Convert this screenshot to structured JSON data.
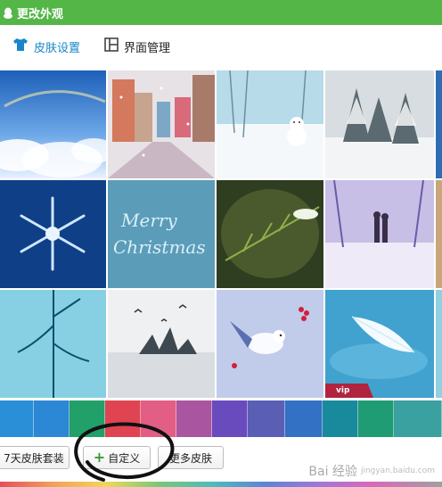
{
  "window": {
    "title": "更改外观"
  },
  "tabs": [
    {
      "label": "皮肤设置",
      "icon": "tshirt-icon",
      "active": true
    },
    {
      "label": "界面管理",
      "icon": "layout-icon",
      "active": false
    }
  ],
  "skins": [
    {
      "theme": "sky-clouds"
    },
    {
      "theme": "snowy-street"
    },
    {
      "theme": "snowman"
    },
    {
      "theme": "snowy-forest"
    },
    {
      "theme": "snowflake"
    },
    {
      "theme": "merry-christmas-frost"
    },
    {
      "theme": "fir-branch-snow"
    },
    {
      "theme": "couple-snow-walk"
    },
    {
      "theme": "frozen-branches"
    },
    {
      "theme": "winter-lake-birds"
    },
    {
      "theme": "bird-red-berries"
    },
    {
      "theme": "white-feather",
      "badge": "vip"
    }
  ],
  "colors": [
    "#2a8fd6",
    "#2c87d4",
    "#21a06a",
    "#e04453",
    "#e25e84",
    "#a9559f",
    "#6a4bbd",
    "#5a5fb5",
    "#3271c4",
    "#188a9c",
    "#1f9c74",
    "#3aa0a0"
  ],
  "buttons": {
    "seven_day": "7天皮肤套装",
    "custom": "自定义",
    "more": "更多皮肤"
  },
  "watermark": {
    "text": "Bai 经验",
    "sub": "jingyan.baidu.com"
  }
}
